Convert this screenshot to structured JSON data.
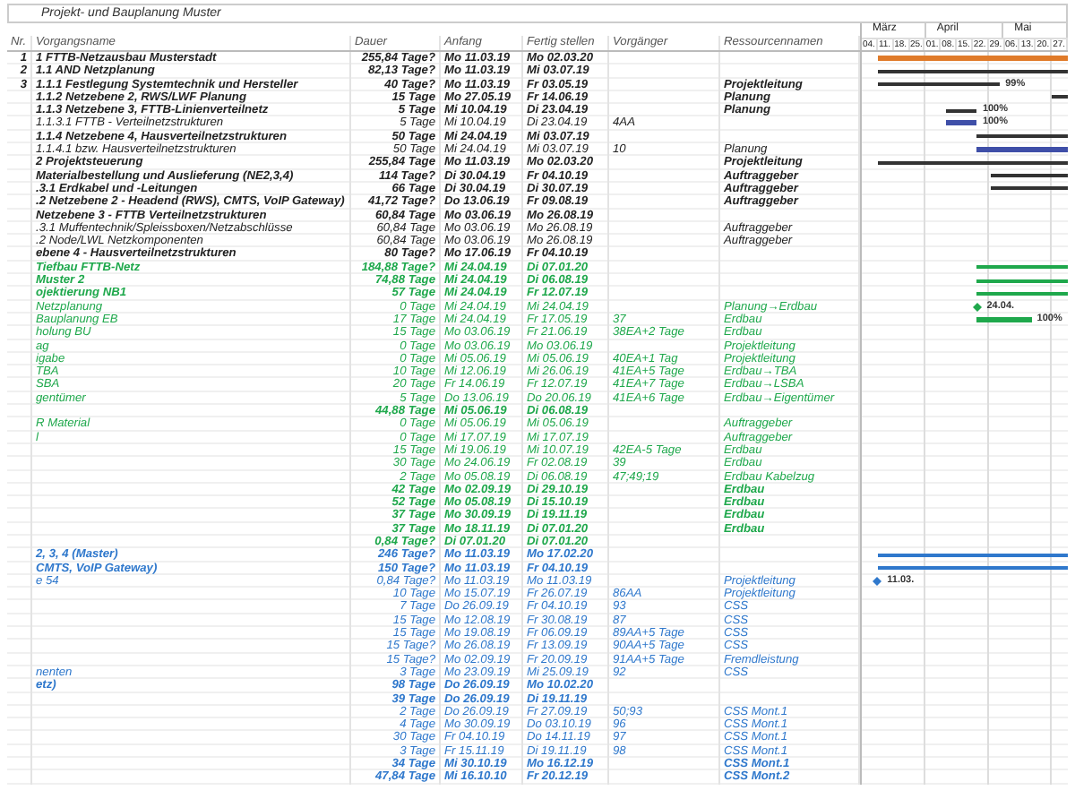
{
  "title": "Projekt- und Bauplanung Muster",
  "columns": [
    "Nr.",
    "Vorgangsname",
    "Dauer",
    "Anfang",
    "Fertig stellen",
    "Vorgänger",
    "Ressourcennamen"
  ],
  "timeline": [
    {
      "month": "März",
      "weeks": [
        "04.",
        "11.",
        "18.",
        "25."
      ]
    },
    {
      "month": "April",
      "weeks": [
        "01.",
        "08.",
        "15.",
        "22.",
        "29."
      ]
    },
    {
      "month": "Mai",
      "weeks": [
        "06.",
        "13.",
        "20.",
        "27."
      ]
    }
  ],
  "rows": [
    {
      "nr": "1",
      "name": "1 FTTB-Netzausbau Musterstadt",
      "duration": "255,84 Tage?",
      "start": "Mo 11.03.19",
      "finish": "Mo 02.03.20",
      "bold": true,
      "color": "#222222",
      "kind": "project"
    },
    {
      "nr": "2",
      "name": "1.1 AND Netzplanung",
      "duration": "82,13 Tage?",
      "start": "Mo 11.03.19",
      "finish": "Mi 03.07.19",
      "bold": true,
      "color": "#222222",
      "kind": "summary"
    },
    {
      "nr": "3",
      "name": "1.1.1 Festlegung  Systemtechnik und Hersteller",
      "duration": "40 Tage?",
      "start": "Mo 11.03.19",
      "finish": "Fr 03.05.19",
      "resource": "Projektleitung",
      "bold": true,
      "color": "#222222",
      "kind": "summary",
      "bar_label": "99%"
    },
    {
      "name": "1.1.2 Netzebene 2, RWS/LWF Planung",
      "duration": "15 Tage",
      "start": "Mo 27.05.19",
      "finish": "Fr 14.06.19",
      "resource": "Planung",
      "bold": true,
      "color": "#222222",
      "kind": "summary"
    },
    {
      "name": "1.1.3 Netzebene 3, FTTB-Linienverteilnetz",
      "duration": "5 Tage",
      "start": "Mi 10.04.19",
      "finish": "Di 23.04.19",
      "resource": "Planung",
      "bold": true,
      "color": "#222222",
      "kind": "summary",
      "bar_label": "100%"
    },
    {
      "name": "1.1.3.1 FTTB - Verteilnetzstrukturen",
      "duration": "5 Tage",
      "start": "Mi 10.04.19",
      "finish": "Di 23.04.19",
      "predecessor": "4AA",
      "bold": false,
      "color": "#222222",
      "kind": "task",
      "bar_label": "100%"
    },
    {
      "name": "1.1.4 Netzebene 4, Hausverteilnetzstrukturen",
      "duration": "50 Tage",
      "start": "Mi 24.04.19",
      "finish": "Mi 03.07.19",
      "bold": true,
      "color": "#222222",
      "kind": "summary"
    },
    {
      "name": "1.1.4.1 bzw. Hausverteilnetzstrukturen",
      "duration": "50 Tage",
      "start": "Mi 24.04.19",
      "finish": "Mi 03.07.19",
      "predecessor": "10",
      "resource": "Planung",
      "bold": false,
      "color": "#222222",
      "kind": "task"
    },
    {
      "name": "2 Projektsteuerung",
      "duration": "255,84 Tage",
      "start": "Mo 11.03.19",
      "finish": "Mo 02.03.20",
      "resource": "Projektleitung",
      "bold": true,
      "color": "#222222",
      "kind": "summary"
    },
    {
      "name": "Materialbestellung und Auslieferung (NE2,3,4)",
      "duration": "114 Tage?",
      "start": "Di 30.04.19",
      "finish": "Fr 04.10.19",
      "resource": "Auftraggeber",
      "bold": true,
      "color": "#222222",
      "kind": "summary"
    },
    {
      "name": ".3.1  Erdkabel und -Leitungen",
      "duration": "66 Tage",
      "start": "Di 30.04.19",
      "finish": "Di 30.07.19",
      "resource": "Auftraggeber",
      "bold": true,
      "color": "#222222",
      "kind": "summary"
    },
    {
      "name": ".2 Netzebene 2 - Headend (RWS), CMTS, VoIP Gateway)",
      "duration": "41,72 Tage?",
      "start": "Do 13.06.19",
      "finish": "Fr 09.08.19",
      "resource": "Auftraggeber",
      "bold": true,
      "color": "#222222"
    },
    {
      "name": "Netzebene 3 - FTTB Verteilnetzstrukturen",
      "duration": "60,84 Tage",
      "start": "Mo 03.06.19",
      "finish": "Mo 26.08.19",
      "bold": true,
      "color": "#222222"
    },
    {
      "name": ".3.1 Muffentechnik/Spleissboxen/Netzabschlüsse",
      "duration": "60,84 Tage",
      "start": "Mo 03.06.19",
      "finish": "Mo 26.08.19",
      "resource": "Auftraggeber",
      "bold": false,
      "color": "#222222"
    },
    {
      "name": ".2 Node/LWL Netzkomponenten",
      "duration": "60,84 Tage",
      "start": "Mo 03.06.19",
      "finish": "Mo 26.08.19",
      "resource": "Auftraggeber",
      "bold": false,
      "color": "#222222"
    },
    {
      "name": "ebene 4 - Hausverteilnetzstrukturen",
      "duration": "80 Tage?",
      "start": "Mo 17.06.19",
      "finish": "Fr 04.10.19",
      "bold": true,
      "color": "#222222"
    },
    {
      "name": "Tiefbau FTTB-Netz",
      "duration": "184,88 Tage?",
      "start": "Mi 24.04.19",
      "finish": "Di 07.01.20",
      "bold": true,
      "color": "#1fa84c",
      "kind": "summary"
    },
    {
      "name": "Muster 2",
      "duration": "74,88 Tage",
      "start": "Mi 24.04.19",
      "finish": "Di 06.08.19",
      "bold": true,
      "color": "#1fa84c",
      "kind": "summary"
    },
    {
      "name": "ojektierung NB1",
      "duration": "57 Tage",
      "start": "Mi 24.04.19",
      "finish": "Fr 12.07.19",
      "bold": true,
      "color": "#1fa84c",
      "kind": "summary"
    },
    {
      "name": "Netzplanung",
      "duration": "0 Tage",
      "start": "Mi 24.04.19",
      "finish": "Mi 24.04.19",
      "resource": "Planung→Erdbau",
      "bold": false,
      "color": "#1fa84c",
      "kind": "milestone",
      "bar_label": "24.04."
    },
    {
      "name": "Bauplanung EB",
      "duration": "17 Tage",
      "start": "Mi 24.04.19",
      "finish": "Fr 17.05.19",
      "predecessor": "37",
      "resource": "Erdbau",
      "bold": false,
      "color": "#1fa84c",
      "kind": "task",
      "bar_label": "100%"
    },
    {
      "name": "holung BU",
      "duration": "15 Tage",
      "start": "Mo 03.06.19",
      "finish": "Fr 21.06.19",
      "predecessor": "38EA+2 Tage",
      "resource": "Erdbau",
      "bold": false,
      "color": "#1fa84c"
    },
    {
      "name": "ag",
      "duration": "0 Tage",
      "start": "Mo 03.06.19",
      "finish": "Mo 03.06.19",
      "resource": "Projektleitung",
      "bold": false,
      "color": "#1fa84c"
    },
    {
      "name": "igabe",
      "duration": "0 Tage",
      "start": "Mi 05.06.19",
      "finish": "Mi 05.06.19",
      "predecessor": "40EA+1 Tag",
      "resource": "Projektleitung",
      "bold": false,
      "color": "#1fa84c"
    },
    {
      "name": "TBA",
      "duration": "10 Tage",
      "start": "Mi 12.06.19",
      "finish": "Mi 26.06.19",
      "predecessor": "41EA+5 Tage",
      "resource": "Erdbau→TBA",
      "bold": false,
      "color": "#1fa84c"
    },
    {
      "name": "SBA",
      "duration": "20 Tage",
      "start": "Fr 14.06.19",
      "finish": "Fr 12.07.19",
      "predecessor": "41EA+7 Tage",
      "resource": "Erdbau→LSBA",
      "bold": false,
      "color": "#1fa84c"
    },
    {
      "name": "gentümer",
      "duration": "5 Tage",
      "start": "Do 13.06.19",
      "finish": "Do 20.06.19",
      "predecessor": "41EA+6 Tage",
      "resource": "Erdbau→Eigentümer",
      "bold": false,
      "color": "#1fa84c"
    },
    {
      "duration": "44,88 Tage",
      "start": "Mi 05.06.19",
      "finish": "Di 06.08.19",
      "bold": true,
      "color": "#1fa84c"
    },
    {
      "name": "R Material",
      "duration": "0 Tage",
      "start": "Mi 05.06.19",
      "finish": "Mi 05.06.19",
      "resource": "Auftraggeber",
      "bold": false,
      "color": "#1fa84c"
    },
    {
      "name": "l",
      "duration": "0 Tage",
      "start": "Mi 17.07.19",
      "finish": "Mi 17.07.19",
      "resource": "Auftraggeber",
      "bold": false,
      "color": "#1fa84c"
    },
    {
      "duration": "15 Tage",
      "start": "Mi 19.06.19",
      "finish": "Mi 10.07.19",
      "predecessor": "42EA-5 Tage",
      "resource": "Erdbau",
      "bold": false,
      "color": "#1fa84c"
    },
    {
      "duration": "30 Tage",
      "start": "Mo 24.06.19",
      "finish": "Fr 02.08.19",
      "predecessor": "39",
      "resource": "Erdbau",
      "bold": false,
      "color": "#1fa84c"
    },
    {
      "duration": "2 Tage",
      "start": "Mo 05.08.19",
      "finish": "Di 06.08.19",
      "predecessor": "47;49;19",
      "resource": "Erdbau Kabelzug",
      "bold": false,
      "color": "#1fa84c"
    },
    {
      "duration": "42 Tage",
      "start": "Mo 02.09.19",
      "finish": "Di 29.10.19",
      "resource": "Erdbau",
      "bold": true,
      "color": "#1fa84c"
    },
    {
      "duration": "52 Tage",
      "start": "Mo 05.08.19",
      "finish": "Di 15.10.19",
      "resource": "Erdbau",
      "bold": true,
      "color": "#1fa84c"
    },
    {
      "duration": "37 Tage",
      "start": "Mo 30.09.19",
      "finish": "Di 19.11.19",
      "resource": "Erdbau",
      "bold": true,
      "color": "#1fa84c"
    },
    {
      "duration": "37 Tage",
      "start": "Mo 18.11.19",
      "finish": "Di 07.01.20",
      "resource": "Erdbau",
      "bold": true,
      "color": "#1fa84c"
    },
    {
      "duration": "0,84 Tage?",
      "start": "Di 07.01.20",
      "finish": "Di 07.01.20",
      "bold": true,
      "color": "#1fa84c"
    },
    {
      "name": "2, 3, 4 (Master)",
      "duration": "246 Tage?",
      "start": "Mo 11.03.19",
      "finish": "Mo 17.02.20",
      "bold": true,
      "color": "#2f78cc",
      "kind": "summary"
    },
    {
      "name": "CMTS, VoIP Gateway)",
      "duration": "150 Tage?",
      "start": "Mo 11.03.19",
      "finish": "Fr 04.10.19",
      "bold": true,
      "color": "#2f78cc",
      "kind": "summary"
    },
    {
      "name": "e 54",
      "duration": "0,84 Tage?",
      "start": "Mo 11.03.19",
      "finish": "Mo 11.03.19",
      "resource": "Projektleitung",
      "bold": false,
      "color": "#2f78cc",
      "kind": "milestone",
      "bar_label": "11.03."
    },
    {
      "duration": "10 Tage",
      "start": "Mo 15.07.19",
      "finish": "Fr 26.07.19",
      "predecessor": "86AA",
      "resource": "Projektleitung",
      "bold": false,
      "color": "#2f78cc"
    },
    {
      "duration": "7 Tage",
      "start": "Do 26.09.19",
      "finish": "Fr 04.10.19",
      "predecessor": "93",
      "resource": "CSS",
      "bold": false,
      "color": "#2f78cc"
    },
    {
      "duration": "15 Tage",
      "start": "Mo 12.08.19",
      "finish": "Fr 30.08.19",
      "predecessor": "87",
      "resource": "CSS",
      "bold": false,
      "color": "#2f78cc"
    },
    {
      "duration": "15 Tage",
      "start": "Mo 19.08.19",
      "finish": "Fr 06.09.19",
      "predecessor": "89AA+5 Tage",
      "resource": "CSS",
      "bold": false,
      "color": "#2f78cc"
    },
    {
      "duration": "15 Tage?",
      "start": "Mo 26.08.19",
      "finish": "Fr 13.09.19",
      "predecessor": "90AA+5 Tage",
      "resource": "CSS",
      "bold": false,
      "color": "#2f78cc"
    },
    {
      "duration": "15 Tage?",
      "start": "Mo 02.09.19",
      "finish": "Fr 20.09.19",
      "predecessor": "91AA+5 Tage",
      "resource": "Fremdleistung",
      "bold": false,
      "color": "#2f78cc"
    },
    {
      "name": "nenten",
      "duration": "3 Tage",
      "start": "Mo 23.09.19",
      "finish": "Mi 25.09.19",
      "predecessor": "92",
      "resource": "CSS",
      "bold": false,
      "color": "#2f78cc"
    },
    {
      "name": "etz)",
      "duration": "98 Tage",
      "start": "Do 26.09.19",
      "finish": "Mo 10.02.20",
      "bold": true,
      "color": "#2f78cc"
    },
    {
      "duration": "39 Tage",
      "start": "Do 26.09.19",
      "finish": "Di 19.11.19",
      "bold": true,
      "color": "#2f78cc"
    },
    {
      "duration": "2 Tage",
      "start": "Do 26.09.19",
      "finish": "Fr 27.09.19",
      "predecessor": "50;93",
      "resource": "CSS Mont.1",
      "bold": false,
      "color": "#2f78cc"
    },
    {
      "duration": "4 Tage",
      "start": "Mo 30.09.19",
      "finish": "Do 03.10.19",
      "predecessor": "96",
      "resource": "CSS Mont.1",
      "bold": false,
      "color": "#2f78cc"
    },
    {
      "duration": "30 Tage",
      "start": "Fr 04.10.19",
      "finish": "Do 14.11.19",
      "predecessor": "97",
      "resource": "CSS Mont.1",
      "bold": false,
      "color": "#2f78cc"
    },
    {
      "duration": "3 Tage",
      "start": "Fr 15.11.19",
      "finish": "Di 19.11.19",
      "predecessor": "98",
      "resource": "CSS Mont.1",
      "bold": false,
      "color": "#2f78cc"
    },
    {
      "duration": "34 Tage",
      "start": "Mi 30.10.19",
      "finish": "Mo 16.12.19",
      "resource": "CSS Mont.1",
      "bold": true,
      "color": "#2f78cc"
    },
    {
      "duration": "47,84 Tage",
      "start": "Mi 16.10.10",
      "finish": "Fr 20.12.19",
      "resource": "CSS Mont.2",
      "bold": true,
      "color": "#2f78cc"
    }
  ]
}
